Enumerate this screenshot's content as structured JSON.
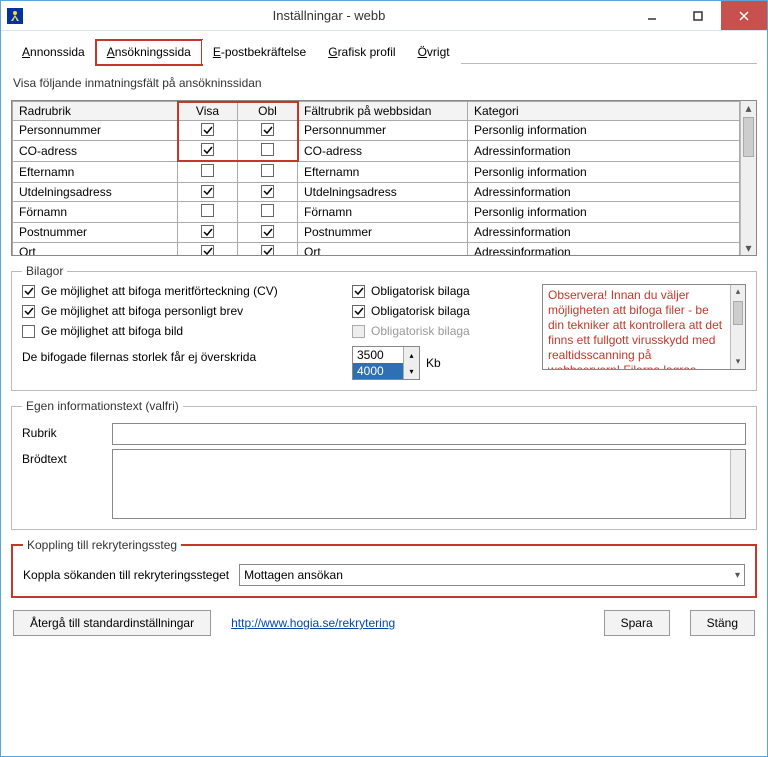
{
  "window": {
    "title": "Inställningar - webb"
  },
  "tabs": {
    "items": [
      {
        "label": "Annonssida",
        "accel": "A"
      },
      {
        "label": "Ansökningssida",
        "accel": "A",
        "active": true,
        "highlight": true
      },
      {
        "label": "E-postbekräftelse",
        "accel": "E"
      },
      {
        "label": "Grafisk profil",
        "accel": "G"
      },
      {
        "label": "Övrigt",
        "accel": "Ö"
      }
    ]
  },
  "fields_section": {
    "heading": "Visa följande inmatningsfält på ansökninssidan",
    "columns": {
      "radrubrik": "Radrubrik",
      "visa": "Visa",
      "obl": "Obl",
      "faltrubrik": "Fältrubrik på webbsidan",
      "kategori": "Kategori"
    },
    "rows": [
      {
        "radrubrik": "Personnummer",
        "visa": true,
        "obl": true,
        "faltrubrik": "Personnummer",
        "kategori": "Personlig information"
      },
      {
        "radrubrik": "CO-adress",
        "visa": true,
        "obl": false,
        "faltrubrik": "CO-adress",
        "kategori": "Adressinformation"
      },
      {
        "radrubrik": "Efternamn",
        "visa": false,
        "obl": false,
        "faltrubrik": "Efternamn",
        "kategori": "Personlig information"
      },
      {
        "radrubrik": "Utdelningsadress",
        "visa": true,
        "obl": true,
        "faltrubrik": "Utdelningsadress",
        "kategori": "Adressinformation"
      },
      {
        "radrubrik": "Förnamn",
        "visa": false,
        "obl": false,
        "faltrubrik": "Förnamn",
        "kategori": "Personlig information"
      },
      {
        "radrubrik": "Postnummer",
        "visa": true,
        "obl": true,
        "faltrubrik": "Postnummer",
        "kategori": "Adressinformation"
      },
      {
        "radrubrik": "Ort",
        "visa": true,
        "obl": true,
        "faltrubrik": "Ort",
        "kategori": "Adressinformation"
      }
    ]
  },
  "bilagor": {
    "legend": "Bilagor",
    "cv": {
      "checked": true,
      "label": "Ge möjlighet att bifoga meritförteckning (CV)",
      "accel": "C"
    },
    "brev": {
      "checked": true,
      "label": "Ge möjlighet att bifoga personligt brev",
      "accel": "e"
    },
    "bild": {
      "checked": false,
      "label": "Ge möjlighet att bifoga bild"
    },
    "oblig1": {
      "checked": true,
      "label": "Obligatorisk bilaga",
      "accel": "O"
    },
    "oblig2": {
      "checked": true,
      "label": "Obligatorisk bilaga",
      "accel": "b"
    },
    "oblig3": {
      "checked": false,
      "label": "Obligatorisk bilaga",
      "disabled": true
    },
    "size_label": "De bifogade filernas storlek får ej överskrida",
    "size_values": [
      "3500",
      "4000"
    ],
    "size_unit": "Kb",
    "note": "Observera! Innan du väljer möjligheten att bifoga filer - be din tekniker att kontrollera att det finns ett fullgott virusskydd med realtidsscanning på webbservern! Filerna lagras"
  },
  "egen_info": {
    "legend": "Egen informationstext (valfri)",
    "rubrik_label": "Rubrik",
    "rubrik_accel": "R",
    "brod_label": "Brödtext",
    "rubrik_value": "",
    "brod_value": ""
  },
  "koppling": {
    "legend": "Koppling till rekryteringssteg",
    "label": "Koppla sökanden till rekryteringssteget",
    "accel": "K",
    "value": "Mottagen ansökan"
  },
  "footer": {
    "reset": "Återgå till standardinställningar",
    "reset_accel": "Å",
    "link_text": "http://www.hogia.se/rekrytering",
    "save": "Spara",
    "save_accel": "S",
    "close": "Stäng"
  }
}
